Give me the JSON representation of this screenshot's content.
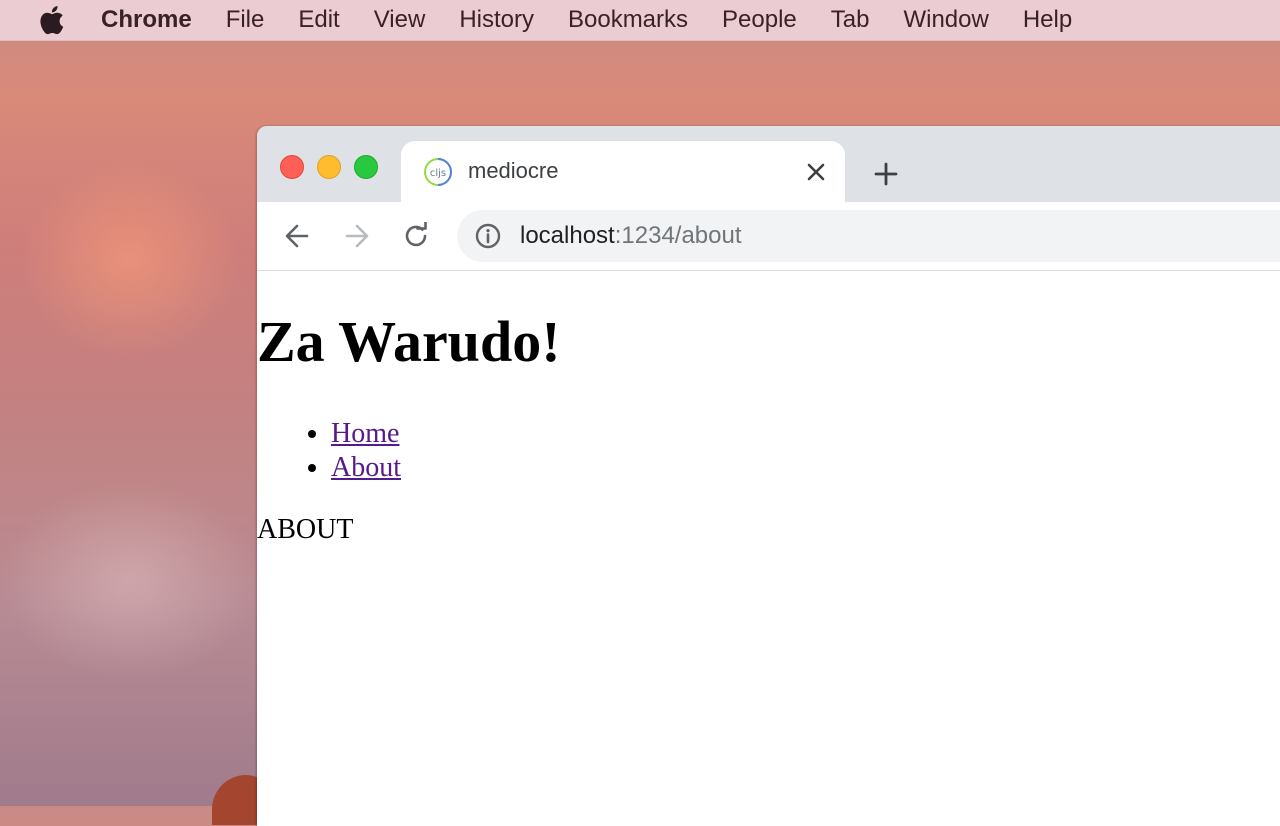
{
  "menubar": {
    "app_name": "Chrome",
    "items": [
      "File",
      "Edit",
      "View",
      "History",
      "Bookmarks",
      "People",
      "Tab",
      "Window",
      "Help"
    ]
  },
  "browser": {
    "tab": {
      "title": "mediocre",
      "favicon_text": "cljs"
    },
    "address": {
      "host": "localhost",
      "path": ":1234/about"
    }
  },
  "page": {
    "heading": "Za Warudo!",
    "nav_links": [
      "Home",
      "About"
    ],
    "content_text": "ABOUT"
  },
  "colors": {
    "close": "#fe5f57",
    "minimize": "#febc2e",
    "maximize": "#28c840",
    "visited_link": "#551a8b"
  }
}
